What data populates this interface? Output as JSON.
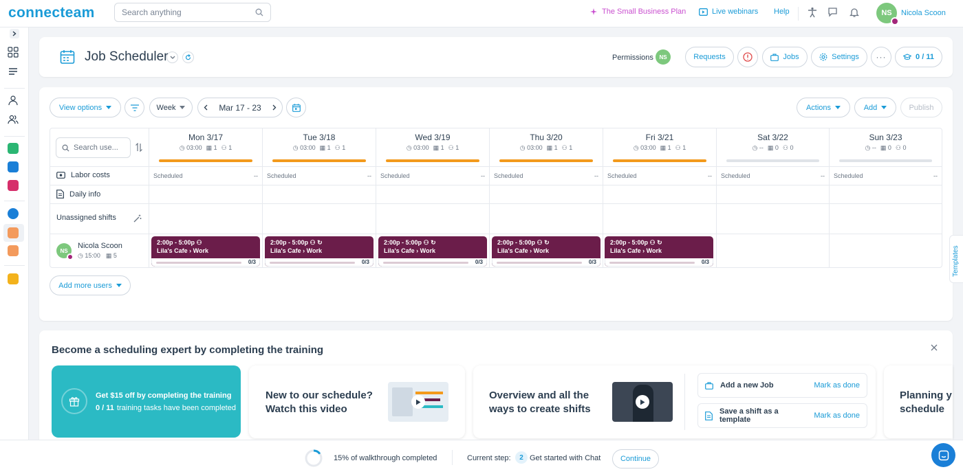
{
  "app": {
    "logo": "connecteam"
  },
  "topbar": {
    "search_placeholder": "Search anything",
    "plan_label": "The Small Business Plan",
    "webinars_label": "Live webinars",
    "help_label": "Help",
    "user_initials": "NS",
    "user_name": "Nicola Scoon"
  },
  "header": {
    "title": "Job Scheduler",
    "permissions_label": "Permissions",
    "permissions_initials": "NS",
    "requests_label": "Requests",
    "jobs_label": "Jobs",
    "settings_label": "Settings",
    "training_progress": "0 / 11"
  },
  "toolbar": {
    "view_options_label": "View options",
    "period_label": "Week",
    "date_range": "Mar 17 - 23",
    "actions_label": "Actions",
    "add_label": "Add",
    "publish_label": "Publish"
  },
  "grid": {
    "search_placeholder": "Search use...",
    "rows": {
      "labor_costs": "Labor costs",
      "daily_info": "Daily info",
      "unassigned_shifts": "Unassigned shifts"
    },
    "days": [
      {
        "name": "Mon 3/17",
        "hours": "03:00",
        "shifts": "1",
        "users": "1",
        "scheduled": "Scheduled",
        "cost": "--"
      },
      {
        "name": "Tue 3/18",
        "hours": "03:00",
        "shifts": "1",
        "users": "1",
        "scheduled": "Scheduled",
        "cost": "--"
      },
      {
        "name": "Wed 3/19",
        "hours": "03:00",
        "shifts": "1",
        "users": "1",
        "scheduled": "Scheduled",
        "cost": "--"
      },
      {
        "name": "Thu 3/20",
        "hours": "03:00",
        "shifts": "1",
        "users": "1",
        "scheduled": "Scheduled",
        "cost": "--"
      },
      {
        "name": "Fri 3/21",
        "hours": "03:00",
        "shifts": "1",
        "users": "1",
        "scheduled": "Scheduled",
        "cost": "--"
      },
      {
        "name": "Sat 3/22",
        "hours": "--",
        "shifts": "0",
        "users": "0",
        "scheduled": "Scheduled",
        "cost": "--"
      },
      {
        "name": "Sun 3/23",
        "hours": "--",
        "shifts": "0",
        "users": "0",
        "scheduled": "Scheduled",
        "cost": "--"
      }
    ],
    "user": {
      "initials": "NS",
      "name": "Nicola Scoon",
      "hours": "15:00",
      "shift_count": "5"
    },
    "shifts": [
      {
        "time": "2:00p - 5:00p",
        "location": "Lila's Cafe › Work",
        "progress": "0/3"
      },
      {
        "time": "2:00p - 5:00p",
        "location": "Lila's Cafe › Work",
        "progress": "0/3"
      },
      {
        "time": "2:00p - 5:00p",
        "location": "Lila's Cafe › Work",
        "progress": "0/3"
      },
      {
        "time": "2:00p - 5:00p",
        "location": "Lila's Cafe › Work",
        "progress": "0/3"
      },
      {
        "time": "2:00p - 5:00p",
        "location": "Lila's Cafe › Work",
        "progress": "0/3"
      }
    ],
    "add_users_label": "Add more users"
  },
  "training": {
    "title": "Become a scheduling expert by completing the training",
    "promo_title": "Get $15 off by completing the training",
    "promo_progress": "0 / 11",
    "promo_sub": "training tasks have been completed",
    "video1_line1": "New to our schedule?",
    "video1_line2": "Watch this video",
    "video2_line1": "Overview and all the",
    "video2_line2": "ways to create shifts",
    "task1": "Add a new Job",
    "task2": "Save a shift as a template",
    "mark_done": "Mark as done",
    "partial_line1": "Planning y",
    "partial_line2": "schedule"
  },
  "templates_tab": "Templates",
  "walkthrough": {
    "progress_text": "15% of walkthrough completed",
    "progress_value": 15,
    "current_step_label": "Current step:",
    "step_number": "2",
    "step_name": "Get started with Chat",
    "continue_label": "Continue"
  },
  "colors": {
    "brand": "#1a9bd7",
    "shift": "#6b1d4a",
    "day_bar_active": "#f39a1c",
    "promo": "#2bbac4",
    "plan": "#c94fcf"
  }
}
